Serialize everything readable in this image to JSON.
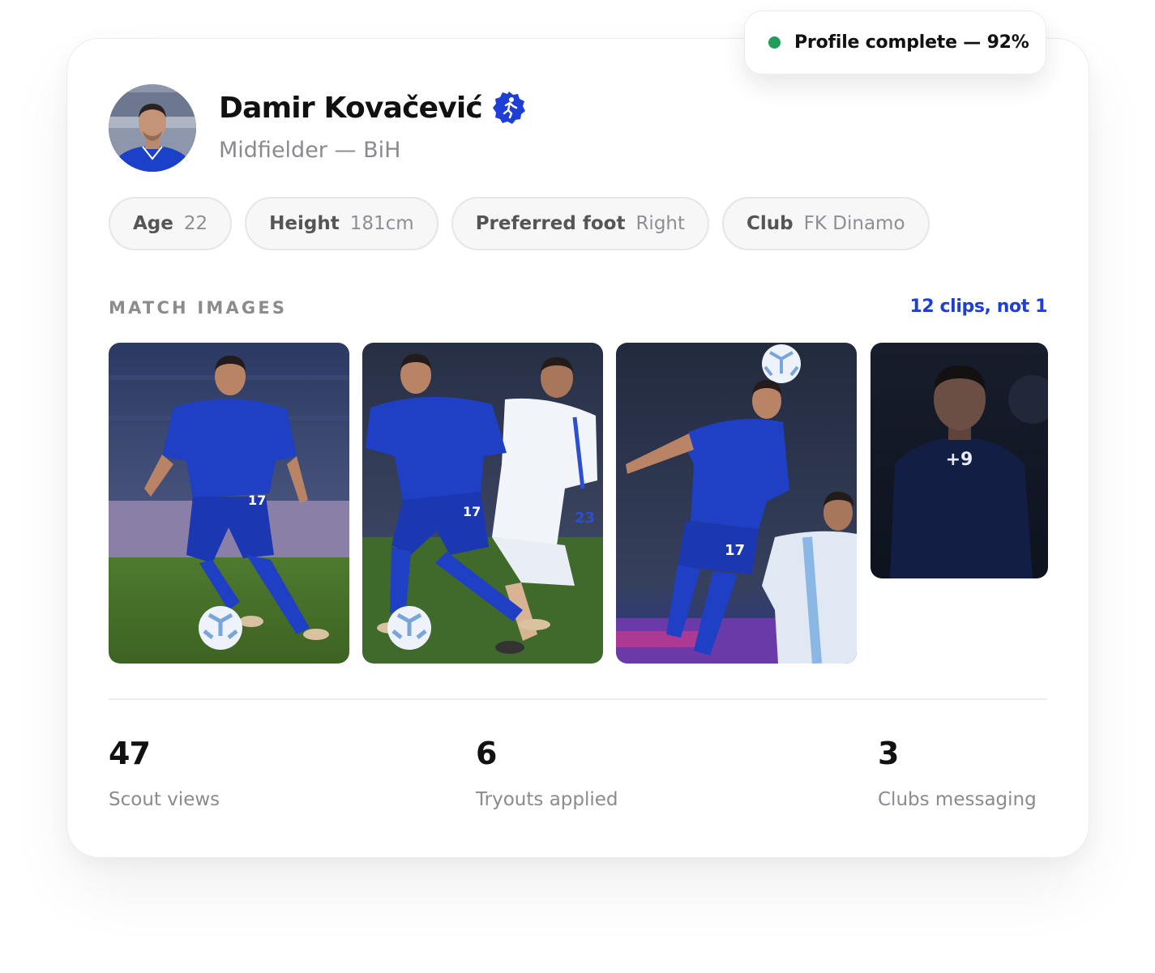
{
  "status_badge": {
    "text": "Profile complete — 92%",
    "color": "#1e9e5a"
  },
  "profile": {
    "name": "Damir Kovačević",
    "subtitle": "Midfielder — BiH",
    "verified_icon": "running-player-badge-icon",
    "accent": "#1d3fd6"
  },
  "chips": [
    {
      "key": "Age",
      "value": "22"
    },
    {
      "key": "Height",
      "value": "181cm"
    },
    {
      "key": "Preferred foot",
      "value": "Right"
    },
    {
      "key": "Club",
      "value": "FK Dinamo"
    }
  ],
  "match_images": {
    "label": "MATCH IMAGES",
    "link": "12 clips, not 1",
    "more_count": "+9",
    "jersey_numbers": [
      "17",
      "17",
      "23",
      "17"
    ]
  },
  "stats": [
    {
      "value": "47",
      "label": "Scout views"
    },
    {
      "value": "6",
      "label": "Tryouts applied"
    },
    {
      "value": "3",
      "label": "Clubs messaging"
    }
  ]
}
